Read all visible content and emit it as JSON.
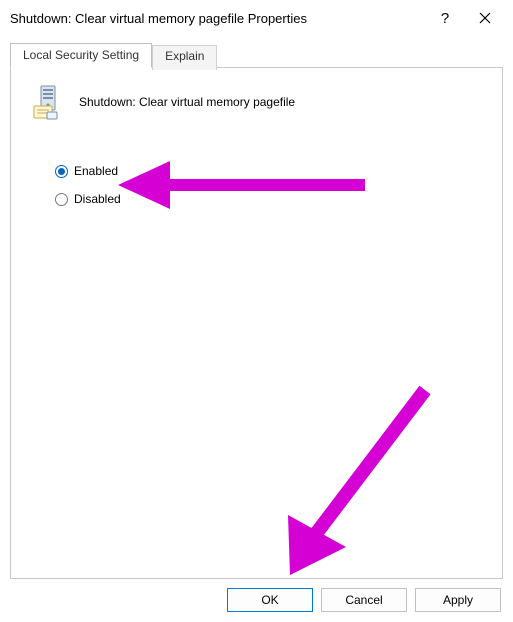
{
  "window": {
    "title": "Shutdown: Clear virtual memory pagefile Properties"
  },
  "tabs": {
    "local": "Local Security Setting",
    "explain": "Explain"
  },
  "policy": {
    "title": "Shutdown: Clear virtual memory pagefile"
  },
  "options": {
    "enabled": "Enabled",
    "disabled": "Disabled",
    "selected": "enabled"
  },
  "buttons": {
    "ok": "OK",
    "cancel": "Cancel",
    "apply": "Apply"
  },
  "annotation": {
    "color": "#d400d4"
  }
}
